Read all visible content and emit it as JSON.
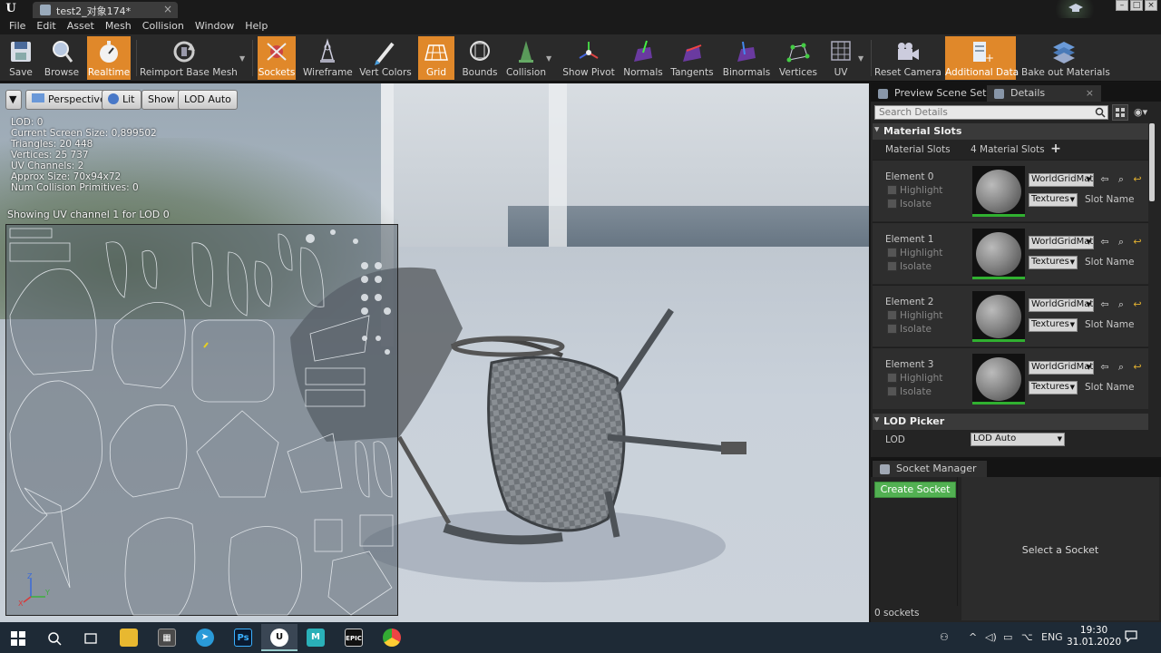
{
  "window": {
    "tab_title": "test2_对象174*",
    "tab_close": "×",
    "logo": "U",
    "win_min": "–",
    "win_max": "□",
    "win_close": "×"
  },
  "menu": [
    "File",
    "Edit",
    "Asset",
    "Mesh",
    "Collision",
    "Window",
    "Help"
  ],
  "toolbar": {
    "save": "Save",
    "browse": "Browse",
    "realtime": "Realtime",
    "reimport": "Reimport Base Mesh",
    "sockets": "Sockets",
    "wireframe": "Wireframe",
    "vert_colors": "Vert Colors",
    "grid": "Grid",
    "bounds": "Bounds",
    "collision": "Collision",
    "show_pivot": "Show Pivot",
    "normals": "Normals",
    "tangents": "Tangents",
    "binormals": "Binormals",
    "vertices": "Vertices",
    "uv": "UV",
    "reset_camera": "Reset Camera",
    "additional_data": "Additional Data",
    "bake_out": "Bake out Materials"
  },
  "viewport": {
    "perspective": "Perspective",
    "lit": "Lit",
    "show": "Show",
    "lod_auto": "LOD Auto",
    "stats": [
      "LOD:  0",
      "Current Screen Size:  0,899502",
      "Triangles:  20 448",
      "Vertices:  25 737",
      "UV Channels:  2",
      "Approx Size: 70x94x72",
      "Num Collision Primitives:  0"
    ],
    "uv_channel_text": "Showing UV channel 1 for LOD 0"
  },
  "details": {
    "tab_preview": "Preview Scene Set",
    "tab_details": "Details",
    "tab_close": "×",
    "search_placeholder": "Search Details",
    "material_slots_header": "Material Slots",
    "material_slots_label": "Material Slots",
    "material_slots_count": "4 Material Slots",
    "elements": [
      {
        "name": "Element 0",
        "highlight": "Highlight",
        "isolate": "Isolate",
        "material": "WorldGridMat",
        "textures": "Textures",
        "slot_name": "Slot Name"
      },
      {
        "name": "Element 1",
        "highlight": "Highlight",
        "isolate": "Isolate",
        "material": "WorldGridMat",
        "textures": "Textures",
        "slot_name": "Slot Name"
      },
      {
        "name": "Element 2",
        "highlight": "Highlight",
        "isolate": "Isolate",
        "material": "WorldGridMat",
        "textures": "Textures",
        "slot_name": "Slot Name"
      },
      {
        "name": "Element 3",
        "highlight": "Highlight",
        "isolate": "Isolate",
        "material": "WorldGridMat",
        "textures": "Textures",
        "slot_name": "Slot Name"
      }
    ],
    "lod_picker_header": "LOD Picker",
    "lod_label": "LOD",
    "lod_value": "LOD Auto"
  },
  "socket_manager": {
    "tab": "Socket Manager",
    "create_button": "Create Socket",
    "select_text": "Select a Socket",
    "count_text": "0 sockets"
  },
  "taskbar": {
    "language": "ENG",
    "time": "19:30",
    "date": "31.01.2020",
    "apps": [
      "windows-start",
      "search",
      "task-view",
      "file-explorer",
      "calculator",
      "telegram",
      "photoshop",
      "unreal-engine",
      "maya",
      "epic-games",
      "chrome"
    ]
  },
  "colors": {
    "accent_orange": "#e0882a",
    "create_green": "#52b052",
    "bg_dark": "#242424"
  }
}
